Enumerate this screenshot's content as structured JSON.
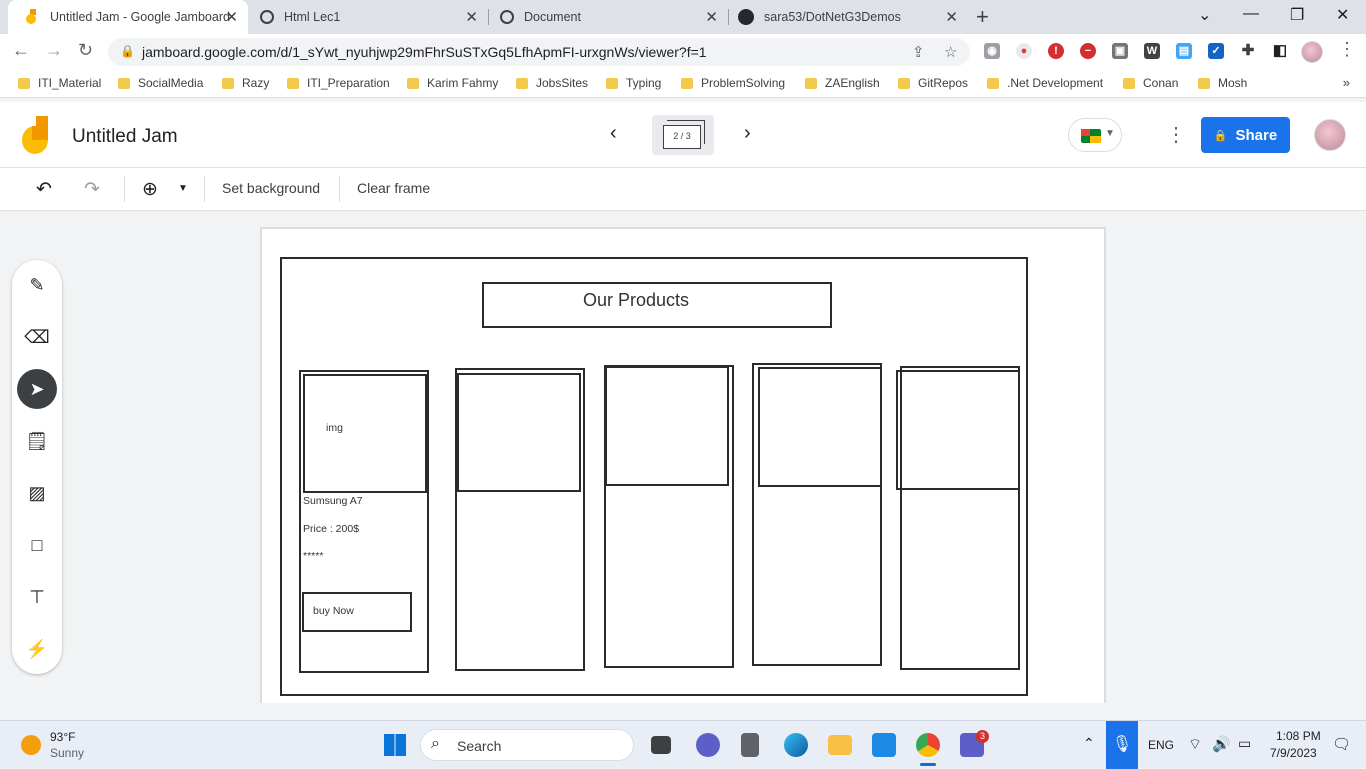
{
  "browser": {
    "tabs": [
      {
        "title": "Untitled Jam - Google Jamboard",
        "active": true,
        "favicon": "jamboard-icon"
      },
      {
        "title": "Html Lec1",
        "active": false,
        "favicon": "globe-icon"
      },
      {
        "title": "Document",
        "active": false,
        "favicon": "globe-icon"
      },
      {
        "title": "sara53/DotNetG3Demos",
        "active": false,
        "favicon": "github-icon"
      }
    ],
    "url": "jamboard.google.com/d/1_sYwt_nyuhjwp29mFhrSuSTxGq5LfhApmFI-urxgnWs/viewer?f=1",
    "bookmarks": [
      "ITI_Material",
      "SocialMedia",
      "Razy",
      "ITI_Preparation",
      "Karim Fahmy",
      "JobsSites",
      "Typing",
      "ProblemSolving",
      "ZAEnglish",
      "GitRepos",
      ".Net Development",
      "Conan",
      "Mosh"
    ]
  },
  "app": {
    "title": "Untitled Jam",
    "frame_indicator": "2 / 3",
    "share_label": "Share",
    "toolbar": {
      "set_background": "Set background",
      "clear_frame": "Clear frame"
    }
  },
  "sketch": {
    "heading": "Our Products",
    "card": {
      "img_label": "img",
      "product_name": "Sumsung A7",
      "price": "Price : 200$",
      "rating": "*****",
      "button": "buy Now"
    }
  },
  "taskbar": {
    "weather_temp": "93°F",
    "weather_desc": "Sunny",
    "search_label": "Search",
    "lang": "ENG",
    "time": "1:08 PM",
    "date": "7/9/2023",
    "teams_badge": "3"
  },
  "colors": {
    "share_blue": "#1a73e8",
    "jamboard_orange": "#f29900",
    "jamboard_yellow": "#fbbc04"
  }
}
